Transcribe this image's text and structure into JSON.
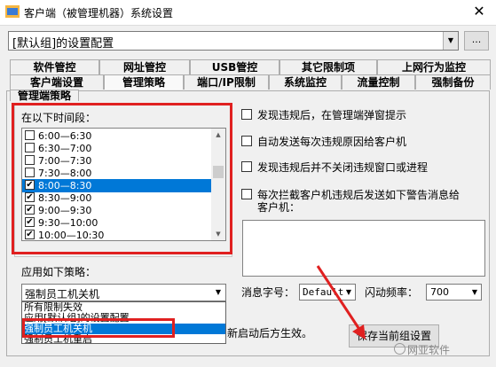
{
  "window": {
    "title": "客户端（被管理机器）系统设置",
    "close_glyph": "✕"
  },
  "config": {
    "value": "[默认组]的设置配置",
    "browse_label": "..."
  },
  "tabs_row1": [
    {
      "label": "软件管控"
    },
    {
      "label": "网址管控"
    },
    {
      "label": "USB管控"
    },
    {
      "label": "其它限制项"
    },
    {
      "label": "上网行为监控"
    }
  ],
  "tabs_row2": [
    {
      "label": "客户端设置"
    },
    {
      "label": "管理策略",
      "active": true
    },
    {
      "label": "端口/IP限制"
    },
    {
      "label": "系统监控"
    },
    {
      "label": "流量控制"
    },
    {
      "label": "强制备份"
    }
  ],
  "tabs_row3": [
    {
      "label": "管理端策略"
    }
  ],
  "time_section": {
    "label": "在以下时间段：",
    "rows": [
      {
        "time": "6:00—6:30",
        "checked": false
      },
      {
        "time": "6:30—7:00",
        "checked": false
      },
      {
        "time": "7:00—7:30",
        "checked": false
      },
      {
        "time": "7:30—8:00",
        "checked": false
      },
      {
        "time": "8:00—8:30",
        "checked": true,
        "selected": true
      },
      {
        "time": "8:30—9:00",
        "checked": true
      },
      {
        "time": "9:00—9:30",
        "checked": true
      },
      {
        "time": "9:30—10:00",
        "checked": true
      },
      {
        "time": "10:00—10:30",
        "checked": true
      }
    ]
  },
  "strategy": {
    "label": "应用如下策略：",
    "value": "强制员工机关机",
    "options": [
      "所有限制失效",
      "应用[默认组]的设置配置",
      "强制员工机关机",
      "强制员工机重启"
    ],
    "highlighted_index": 2
  },
  "options": [
    {
      "label": "发现违规后，在管理端弹窗提示"
    },
    {
      "label": "自动发送每次违规原因给客户机"
    },
    {
      "label": "发现违规后并不关闭违规窗口或进程"
    },
    {
      "label": "每次拦截客户机违规后发送如下警告消息给",
      "label2": "客户机："
    }
  ],
  "message": {
    "value": ""
  },
  "fontsize": {
    "label": "消息字号：",
    "value": "Default"
  },
  "frequency": {
    "label": "闪动频率：",
    "value": "700"
  },
  "hint": {
    "text": "新启动后方生效。"
  },
  "save_label": "保存当前组设置",
  "watermark": "网亚软件",
  "colors": {
    "annotation_red": "#e02020",
    "selection_blue": "#0078d7"
  }
}
